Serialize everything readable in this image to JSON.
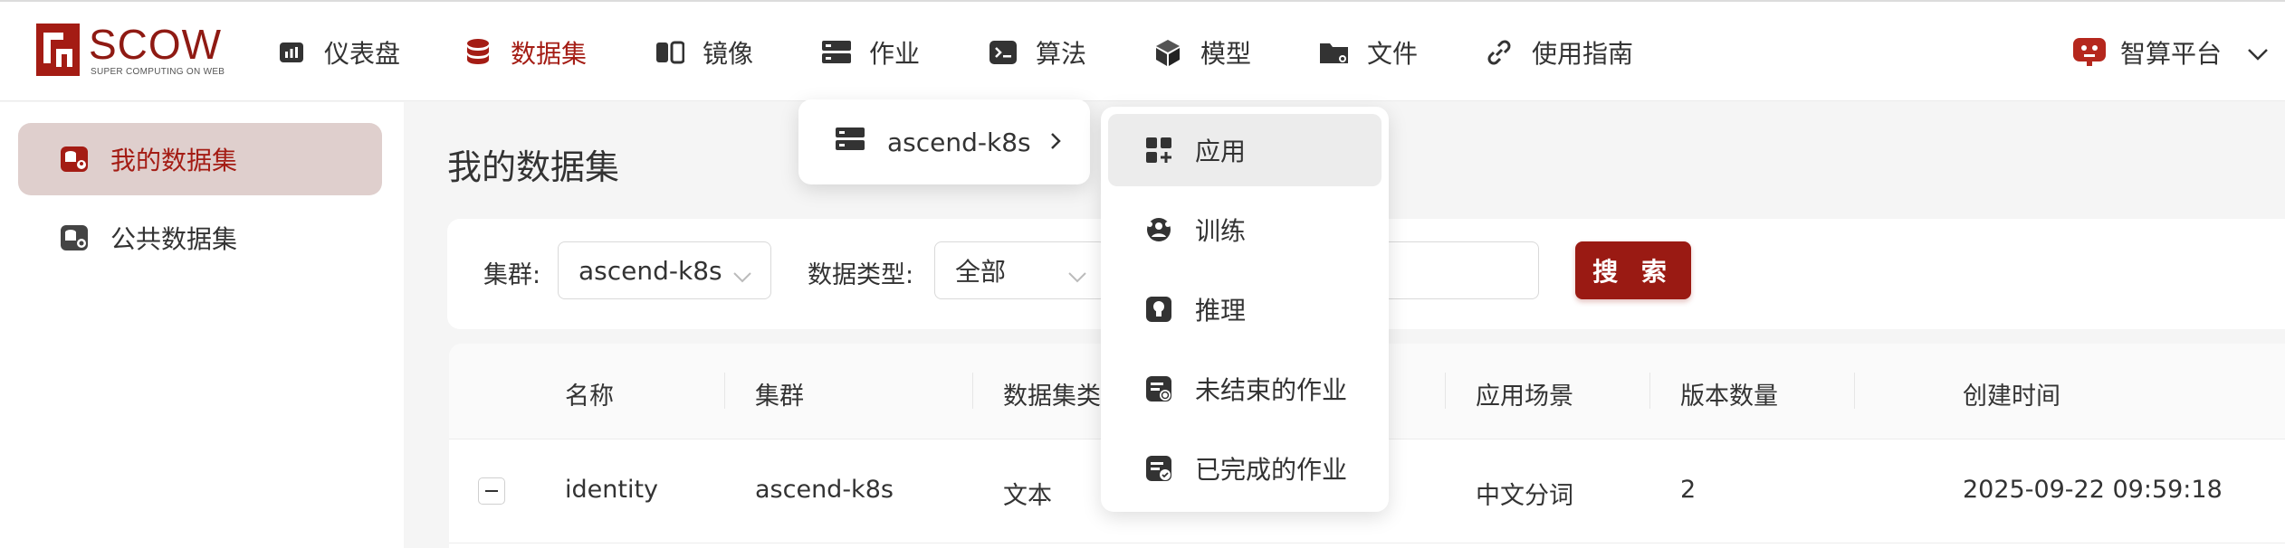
{
  "logo": {
    "text": "SCOW",
    "sub": "SUPER COMPUTING ON WEB"
  },
  "nav": {
    "items": [
      {
        "label": "仪表盘",
        "icon": "dashboard-icon"
      },
      {
        "label": "数据集",
        "icon": "database-icon"
      },
      {
        "label": "镜像",
        "icon": "image-icon"
      },
      {
        "label": "作业",
        "icon": "server-icon"
      },
      {
        "label": "算法",
        "icon": "terminal-icon"
      },
      {
        "label": "模型",
        "icon": "cube-icon"
      },
      {
        "label": "文件",
        "icon": "folder-icon"
      },
      {
        "label": "使用指南",
        "icon": "link-icon"
      }
    ],
    "active": "数据集",
    "platform": "智算平台"
  },
  "sidebar": {
    "items": [
      {
        "label": "我的数据集"
      },
      {
        "label": "公共数据集"
      }
    ]
  },
  "main": {
    "title": "我的数据集",
    "filters": {
      "cluster_label": "集群:",
      "cluster_value": "ascend-k8s",
      "type_label": "数据类型:",
      "type_value": "全部",
      "search_button": "搜 索"
    },
    "table": {
      "columns": [
        "名称",
        "集群",
        "数据集类",
        "应用场景",
        "版本数量",
        "创建时间"
      ],
      "rows": [
        {
          "name": "identity",
          "cluster": "ascend-k8s",
          "type": "文本",
          "scene": "中文分词",
          "versions": "2",
          "created": "2025-09-22 09:59:18"
        }
      ]
    }
  },
  "cluster_menu": {
    "item": "ascend-k8s"
  },
  "job_menu": {
    "items": [
      {
        "label": "应用",
        "icon": "apps-icon"
      },
      {
        "label": "训练",
        "icon": "training-icon"
      },
      {
        "label": "推理",
        "icon": "inference-icon"
      },
      {
        "label": "未结束的作业",
        "icon": "running-jobs-icon"
      },
      {
        "label": "已完成的作业",
        "icon": "finished-jobs-icon"
      }
    ],
    "active": "应用"
  },
  "colors": {
    "brand": "#9a1a13",
    "active_bg": "#dfcfcd"
  }
}
